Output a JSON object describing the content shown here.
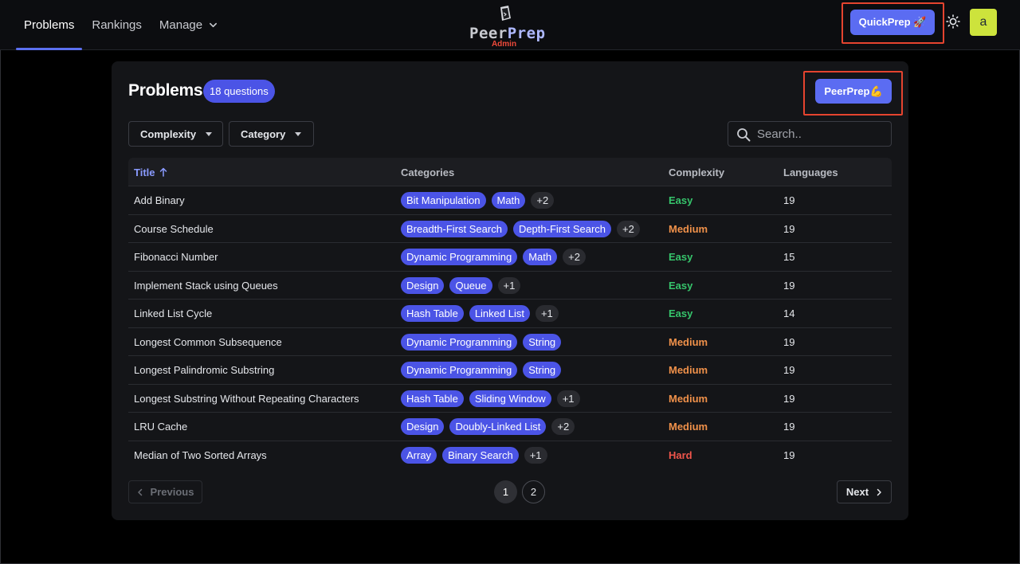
{
  "nav": {
    "links": [
      {
        "label": "Problems",
        "active": true
      },
      {
        "label": "Rankings",
        "active": false
      },
      {
        "label": "Manage",
        "active": false
      }
    ],
    "logo_peer": "Peer",
    "logo_prep": "Prep",
    "logo_sub": "Admin",
    "quickprep_label": "QuickPrep 🚀",
    "avatar_letter": "a"
  },
  "main": {
    "title": "Problems",
    "count_badge": "18 questions",
    "peerprep_button": "PeerPrep💪",
    "filters": {
      "complexity": "Complexity",
      "category": "Category"
    },
    "search_placeholder": "Search.."
  },
  "table": {
    "headers": [
      "Title",
      "Categories",
      "Complexity",
      "Languages"
    ],
    "rows": [
      {
        "title": "Add Binary",
        "tags": [
          "Bit Manipulation",
          "Math",
          "+2"
        ],
        "complexity": "Easy",
        "languages": "19"
      },
      {
        "title": "Course Schedule",
        "tags": [
          "Breadth-First Search",
          "Depth-First Search",
          "+2"
        ],
        "complexity": "Medium",
        "languages": "19"
      },
      {
        "title": "Fibonacci Number",
        "tags": [
          "Dynamic Programming",
          "Math",
          "+2"
        ],
        "complexity": "Easy",
        "languages": "15"
      },
      {
        "title": "Implement Stack using Queues",
        "tags": [
          "Design",
          "Queue",
          "+1"
        ],
        "complexity": "Easy",
        "languages": "19"
      },
      {
        "title": "Linked List Cycle",
        "tags": [
          "Hash Table",
          "Linked List",
          "+1"
        ],
        "complexity": "Easy",
        "languages": "14"
      },
      {
        "title": "Longest Common Subsequence",
        "tags": [
          "Dynamic Programming",
          "String"
        ],
        "complexity": "Medium",
        "languages": "19"
      },
      {
        "title": "Longest Palindromic Substring",
        "tags": [
          "Dynamic Programming",
          "String"
        ],
        "complexity": "Medium",
        "languages": "19"
      },
      {
        "title": "Longest Substring Without Repeating Characters",
        "tags": [
          "Hash Table",
          "Sliding Window",
          "+1"
        ],
        "complexity": "Medium",
        "languages": "19"
      },
      {
        "title": "LRU Cache",
        "tags": [
          "Design",
          "Doubly-Linked List",
          "+2"
        ],
        "complexity": "Medium",
        "languages": "19"
      },
      {
        "title": "Median of Two Sorted Arrays",
        "tags": [
          "Array",
          "Binary Search",
          "+1"
        ],
        "complexity": "Hard",
        "languages": "19"
      }
    ]
  },
  "pagination": {
    "previous": "Previous",
    "next": "Next",
    "pages": [
      "1",
      "2"
    ]
  },
  "colors": {
    "accent": "#5b6cf2",
    "easy": "#36c46b",
    "medium": "#f0914a",
    "hard": "#f0554b",
    "highlight_box": "#e5442f"
  }
}
